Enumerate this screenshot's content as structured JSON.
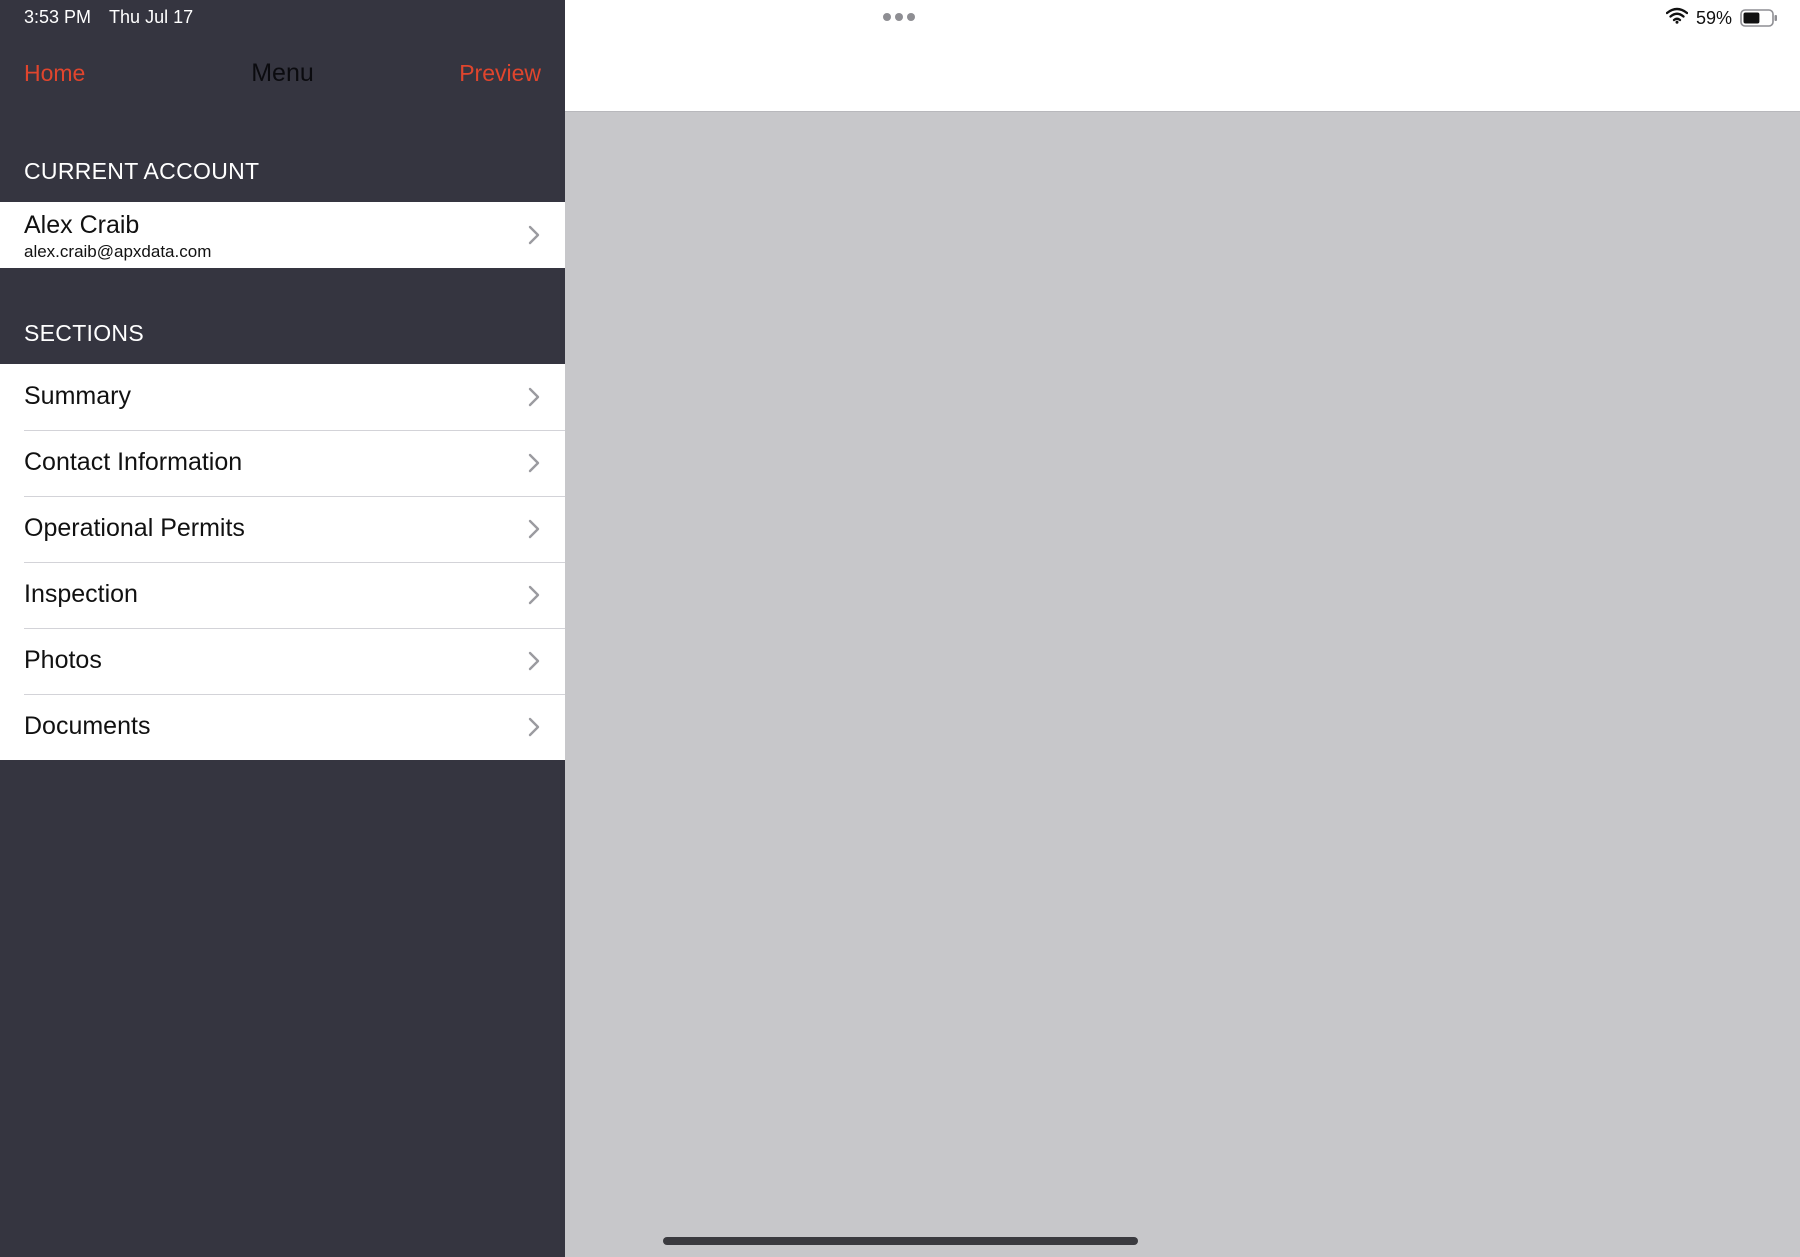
{
  "status_bar": {
    "time": "3:53 PM",
    "date": "Thu Jul 17",
    "battery_percent": "59%",
    "battery_level": 0.59
  },
  "nav": {
    "home_label": "Home",
    "title": "Menu",
    "preview_label": "Preview"
  },
  "account_section": {
    "header": "CURRENT ACCOUNT",
    "name": "Alex Craib",
    "email": "alex.craib@apxdata.com"
  },
  "sections": {
    "header": "SECTIONS",
    "items": [
      {
        "label": "Summary"
      },
      {
        "label": "Contact Information"
      },
      {
        "label": "Operational Permits"
      },
      {
        "label": "Inspection"
      },
      {
        "label": "Photos"
      },
      {
        "label": "Documents"
      }
    ]
  },
  "icons": {
    "chevron": "chevron-right-icon",
    "wifi": "wifi-icon",
    "battery": "battery-icon",
    "multitask": "more-dots-icon"
  },
  "colors": {
    "sidebar_bg": "#353540",
    "accent": "#e0452d",
    "detail_bg": "#c7c7ca",
    "row_bg": "#ffffff"
  }
}
